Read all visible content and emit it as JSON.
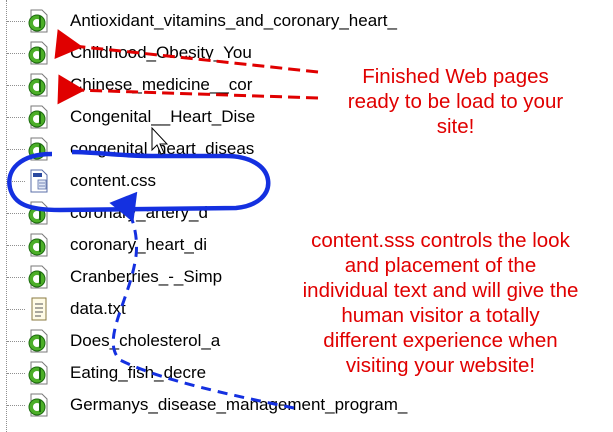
{
  "files": [
    {
      "name": "Antioxidant_vitamins_and_coronary_heart_",
      "icon": "html-page-icon"
    },
    {
      "name": "Childhood_Obesity_You",
      "icon": "html-page-icon"
    },
    {
      "name": "Chinese_medicine__cor",
      "icon": "html-page-icon"
    },
    {
      "name": "Congenital__Heart_Dise",
      "icon": "html-page-icon"
    },
    {
      "name": "congenital_heart_diseas",
      "icon": "html-page-icon"
    },
    {
      "name": "content.css",
      "icon": "css-file-icon"
    },
    {
      "name": "coronary_artery_d",
      "icon": "html-page-icon"
    },
    {
      "name": "coronary_heart_di",
      "icon": "html-page-icon"
    },
    {
      "name": "Cranberries_-_Simp",
      "icon": "html-page-icon"
    },
    {
      "name": "data.txt",
      "icon": "text-file-icon"
    },
    {
      "name": "Does_cholesterol_a",
      "icon": "html-page-icon"
    },
    {
      "name": "Eating_fish_decre",
      "icon": "html-page-icon"
    },
    {
      "name": "Germanys_disease_management_program_",
      "icon": "html-page-icon"
    }
  ],
  "annotations": {
    "finished": {
      "lines": [
        "Finished Web pages",
        "ready to be load to your",
        "site!"
      ]
    },
    "css": {
      "lines": [
        "content.sss controls the look",
        "and placement of the",
        "individual text and will give the",
        "human visitor a totally",
        "different experience when",
        "visiting your website!"
      ]
    }
  },
  "colors": {
    "annotation_text": "#e00000",
    "red_arrow": "#e00000",
    "blue_highlight": "#1430e0"
  }
}
